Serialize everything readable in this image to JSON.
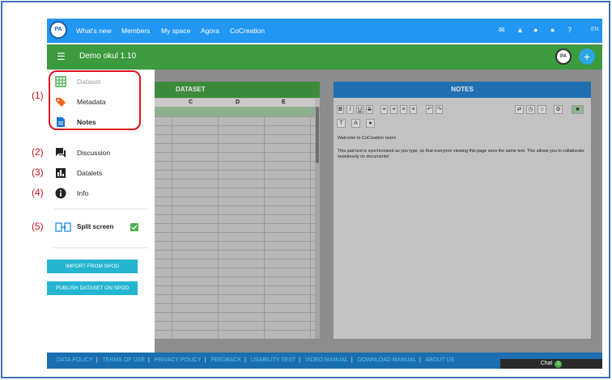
{
  "topnav": {
    "logo": "PA",
    "items": [
      "What's new",
      "Members",
      "My space",
      "Agora",
      "CoCreation"
    ],
    "lang": "EN",
    "icons": [
      "mail-icon",
      "bell-icon",
      "person-icon",
      "person-icon",
      "help-icon"
    ],
    "help_glyph": "?"
  },
  "header": {
    "title": "Demo okul 1.10",
    "avatar": "PA",
    "add": "+"
  },
  "sidebar": {
    "items": [
      {
        "label": "Dataset",
        "icon": "grid-icon"
      },
      {
        "label": "Metadata",
        "icon": "tag-icon"
      },
      {
        "label": "Notes",
        "icon": "document-icon"
      },
      {
        "label": "Discussion",
        "icon": "chat-icon"
      },
      {
        "label": "Datalets",
        "icon": "bar-chart-icon"
      },
      {
        "label": "Info",
        "icon": "info-icon"
      },
      {
        "label": "Split screen",
        "icon": "split-screen-icon"
      }
    ],
    "buttons": {
      "import": "IMPORT FROM SPOD",
      "publish": "PUBLISH DATASET ON SPOD"
    }
  },
  "annotations": [
    "(1)",
    "(2)",
    "(3)",
    "(4)",
    "(5)"
  ],
  "dataset": {
    "title": "DATASET",
    "columns": [
      "C",
      "D",
      "E"
    ]
  },
  "notes": {
    "title": "NOTES",
    "toolbar1": [
      "B",
      "I",
      "U",
      "S"
    ],
    "toolbar2": [
      "T",
      "A"
    ],
    "text1": "Welcome to CoCreation room!",
    "text2": "This pad text is synchronized as you type, so that everyone viewing this page sees the same text. This allows you to collaborate seamlessly on documents!"
  },
  "footer": {
    "links": [
      "DATA POLICY",
      "TERMS OF USE",
      "PRIVACY POLICY",
      "FEEDBACK",
      "USABILITY TEST",
      "VIDEO MANUAL",
      "DOWNLOAD MANUAL",
      "ABOUT US"
    ],
    "chat": "Chat",
    "chat_count": "1"
  },
  "colors": {
    "nav": "#2196f3",
    "header": "#3c9a3f",
    "accent": "#24b5d1",
    "annotation": "#d0121b"
  }
}
